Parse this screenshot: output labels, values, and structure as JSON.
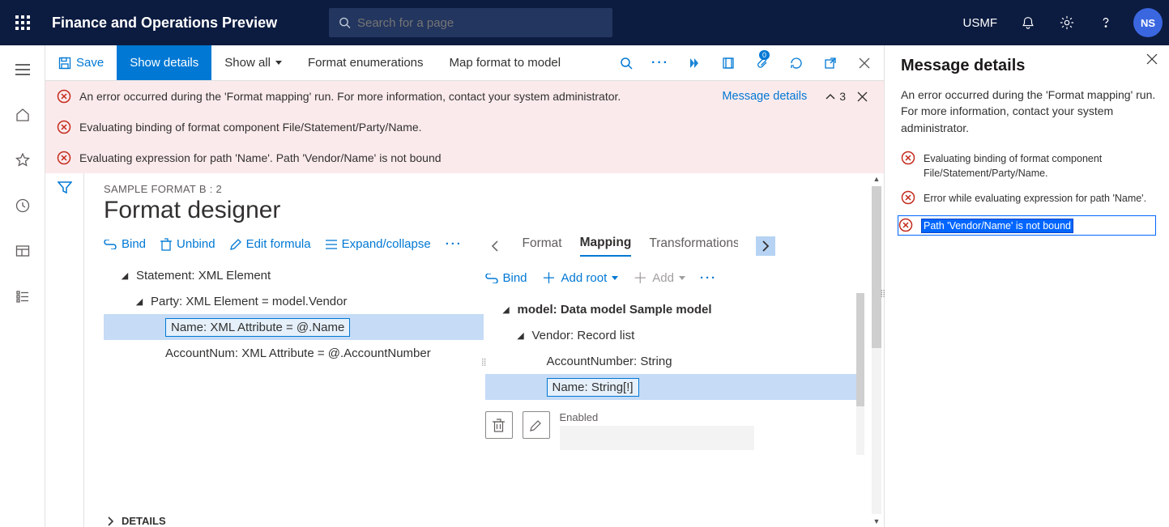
{
  "header": {
    "app_title": "Finance and Operations Preview",
    "search_placeholder": "Search for a page",
    "company": "USMF",
    "avatar": "NS"
  },
  "actions": {
    "save": "Save",
    "show_details": "Show details",
    "show_all": "Show all",
    "format_enum": "Format enumerations",
    "map_format": "Map format to model",
    "attach_badge": "0"
  },
  "errors": {
    "rows": [
      "An error occurred during the 'Format mapping' run. For more information, contact your system administrator.",
      "Evaluating binding of format component File/Statement/Party/Name.",
      "Evaluating expression for path 'Name'.   Path 'Vendor/Name' is not bound"
    ],
    "details_link": "Message details",
    "count": "3"
  },
  "designer": {
    "crumb": "SAMPLE FORMAT B : 2",
    "title": "Format designer",
    "left_toolbar": {
      "bind": "Bind",
      "unbind": "Unbind",
      "edit": "Edit formula",
      "expand": "Expand/collapse"
    },
    "left_tree": {
      "n0": "Statement: XML Element",
      "n1": "Party: XML Element = model.Vendor",
      "n2": "Name: XML Attribute = @.Name",
      "n3": "AccountNum: XML Attribute = @.AccountNumber"
    },
    "tabs": {
      "format": "Format",
      "mapping": "Mapping",
      "trans": "Transformations"
    },
    "right_toolbar": {
      "bind": "Bind",
      "addroot": "Add root",
      "add": "Add"
    },
    "right_tree": {
      "n0": "model: Data model Sample model",
      "n1": "Vendor: Record list",
      "n2": "AccountNumber: String",
      "n3": "Name: String[!]"
    },
    "enabled_label": "Enabled",
    "details": "DETAILS"
  },
  "side": {
    "title": "Message details",
    "desc": "An error occurred during the 'Format mapping' run. For more information, contact your system administrator.",
    "items": [
      "Evaluating binding of format component File/Statement/Party/Name.",
      "Error while evaluating expression for path 'Name'.",
      "Path 'Vendor/Name' is not bound"
    ]
  }
}
